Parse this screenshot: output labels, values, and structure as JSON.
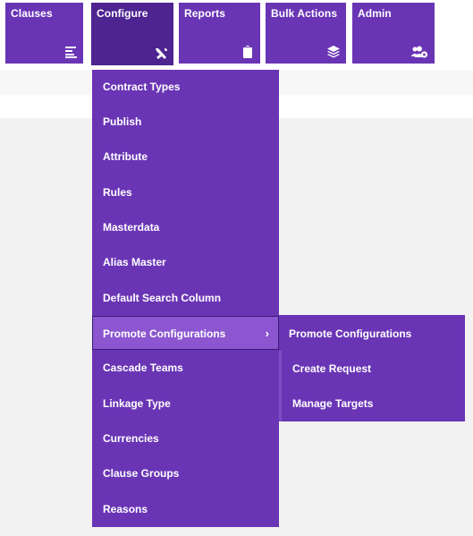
{
  "nav": {
    "tiles": [
      {
        "label": "Clauses",
        "icon": "list-align-icon"
      },
      {
        "label": "Configure",
        "icon": "tools-icon"
      },
      {
        "label": "Reports",
        "icon": "clipboard-icon"
      },
      {
        "label": "Bulk Actions",
        "icon": "layers-icon"
      },
      {
        "label": "Admin",
        "icon": "users-gear-icon"
      }
    ]
  },
  "configure_menu": {
    "items": [
      "Contract Types",
      "Publish",
      "Attribute",
      "Rules",
      "Masterdata",
      "Alias Master",
      "Default Search Column",
      "Promote Configurations",
      "Cascade Teams",
      "Linkage Type",
      "Currencies",
      "Clause Groups",
      "Reasons"
    ],
    "chevron": "›"
  },
  "promote_submenu": {
    "items": [
      "Promote Configurations",
      "Create Request",
      "Manage Targets"
    ]
  },
  "colors": {
    "tile_bg": "#6a35b5",
    "tile_active_bg": "#4d2490",
    "menu_bg": "#6a35b5",
    "menu_highlight_bg": "#8b56cf"
  }
}
